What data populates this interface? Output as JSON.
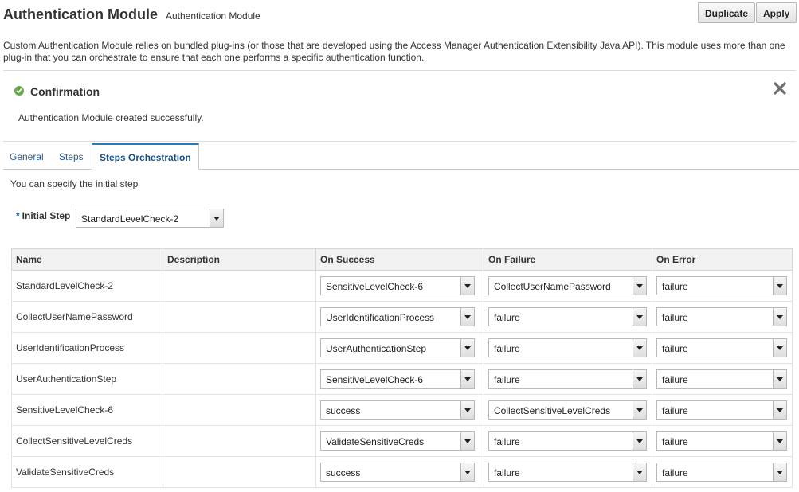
{
  "header": {
    "title": "Authentication Module",
    "subtitle": "Authentication Module"
  },
  "toolbar": {
    "duplicate_label": "Duplicate",
    "apply_label": "Apply"
  },
  "description": "Custom Authentication Module relies on bundled plug-ins (or those that are developed using the Access Manager Authentication Extensibility Java API). This module uses more than one plug-in that you can orchestrate to ensure that each one performs a specific authentication function.",
  "confirmation": {
    "icon": "success-check-icon",
    "title": "Confirmation",
    "message": "Authentication Module created successfully.",
    "close_icon": "close-icon"
  },
  "tabs": [
    {
      "label": "General",
      "active": false
    },
    {
      "label": "Steps",
      "active": false
    },
    {
      "label": "Steps Orchestration",
      "active": true
    }
  ],
  "orchestration": {
    "hint": "You can specify the initial step",
    "initial_step": {
      "required_marker": "*",
      "label": "Initial Step",
      "value": "StandardLevelCheck-2"
    },
    "columns": [
      "Name",
      "Description",
      "On Success",
      "On Failure",
      "On Error"
    ],
    "rows": [
      {
        "name": "StandardLevelCheck-2",
        "description": "",
        "on_success": "SensitiveLevelCheck-6",
        "on_failure": "CollectUserNamePassword",
        "on_error": "failure"
      },
      {
        "name": "CollectUserNamePassword",
        "description": "",
        "on_success": "UserIdentificationProcess",
        "on_failure": "failure",
        "on_error": "failure"
      },
      {
        "name": "UserIdentificationProcess",
        "description": "",
        "on_success": "UserAuthenticationStep",
        "on_failure": "failure",
        "on_error": "failure"
      },
      {
        "name": "UserAuthenticationStep",
        "description": "",
        "on_success": "SensitiveLevelCheck-6",
        "on_failure": "failure",
        "on_error": "failure"
      },
      {
        "name": "SensitiveLevelCheck-6",
        "description": "",
        "on_success": "success",
        "on_failure": "CollectSensitiveLevelCreds",
        "on_error": "failure"
      },
      {
        "name": "CollectSensitiveLevelCreds",
        "description": "",
        "on_success": "ValidateSensitiveCreds",
        "on_failure": "failure",
        "on_error": "failure"
      },
      {
        "name": "ValidateSensitiveCreds",
        "description": "",
        "on_success": "success",
        "on_failure": "failure",
        "on_error": "failure"
      }
    ]
  },
  "colors": {
    "accent": "#2a7ab8",
    "tab_text": "#2a5d8f",
    "success": "#6aa84f"
  }
}
